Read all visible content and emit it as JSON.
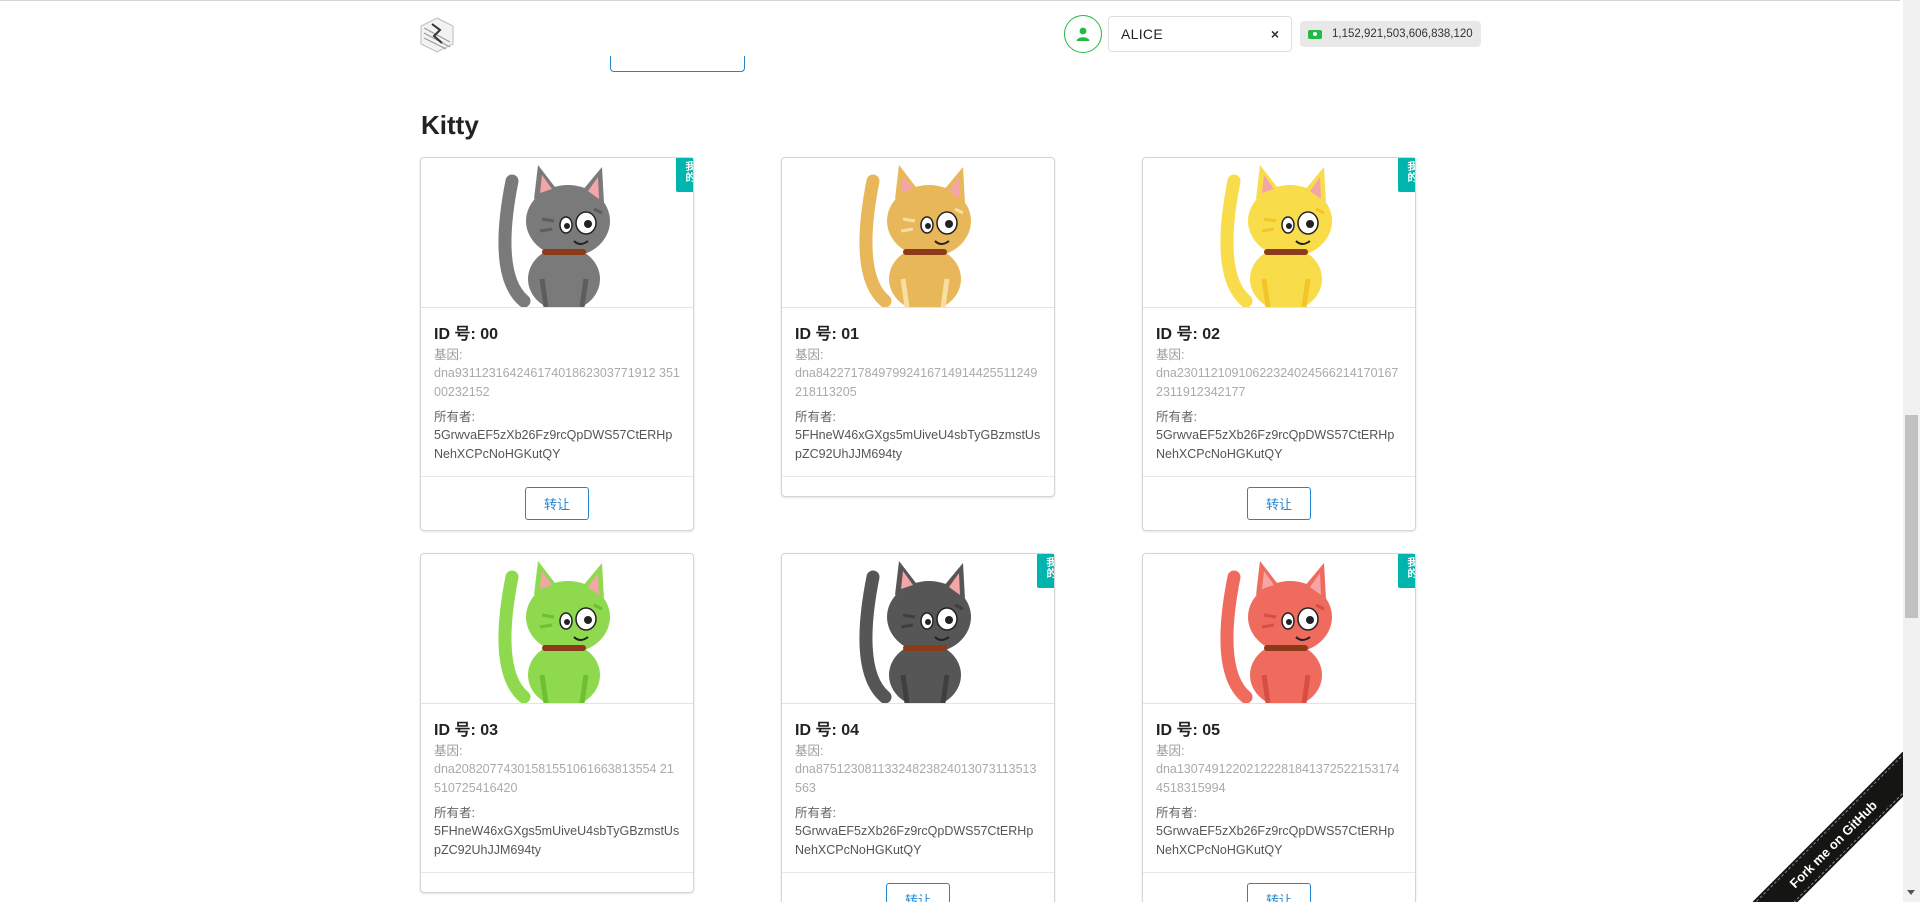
{
  "header": {
    "account_name": "ALICE",
    "clear_glyph": "×",
    "balance": "1,152,921,503,606,838,120",
    "icons": {
      "logo": "cube-logo-icon",
      "user": "user-icon",
      "cash": "money-icon"
    }
  },
  "section": {
    "title": "Kitty"
  },
  "labels": {
    "gene": "基因:",
    "owner": "所有者:",
    "transfer": "转让",
    "mine_badge": "我的"
  },
  "kitties": [
    {
      "id_label": "ID 号: 00",
      "dna": "dna93112316424617401862303771912 35100232152",
      "owner": "5GrwvaEF5zXb26Fz9rcQpDWS57CtERHpNehXCPcNoHGKutQY",
      "mine": true,
      "color": "#7a7a7a",
      "stripe": "#5d5d5d"
    },
    {
      "id_label": "ID 号: 01",
      "dna": "dna84227178497992416714914425511249218113205",
      "owner": "5FHneW46xGXgs5mUiveU4sbTyGBzmstUspZC92UhJJM694ty",
      "mine": false,
      "color": "#e8b75a",
      "stripe": "#f6dfa0"
    },
    {
      "id_label": "ID 号: 02",
      "dna": "dna230112109106223240245662141701672311912342177",
      "owner": "5GrwvaEF5zXb26Fz9rcQpDWS57CtERHpNehXCPcNoHGKutQY",
      "mine": true,
      "color": "#f9dc4a",
      "stripe": "#f3c52a"
    },
    {
      "id_label": "ID 号: 03",
      "dna": "dna20820774301581551061663813554 21510725416420",
      "owner": "5FHneW46xGXgs5mUiveU4sbTyGBzmstUspZC92UhJJM694ty",
      "mine": false,
      "color": "#8fd94f",
      "stripe": "#6dbf34"
    },
    {
      "id_label": "ID 号: 04",
      "dna": "dna87512308113324823824013073113513563",
      "owner": "5GrwvaEF5zXb26Fz9rcQpDWS57CtERHpNehXCPcNoHGKutQY",
      "mine": true,
      "color": "#565656",
      "stripe": "#3f3f3f"
    },
    {
      "id_label": "ID 号: 05",
      "dna": "dna130749122021222818413725221531744518315994",
      "owner": "5GrwvaEF5zXb26Fz9rcQpDWS57CtERHpNehXCPcNoHGKutQY",
      "mine": true,
      "color": "#ef6b5e",
      "stripe": "#d94e44"
    }
  ],
  "ribbon": {
    "text": "Fork me on GitHub"
  },
  "colors": {
    "accent_blue": "#2185d0",
    "badge_teal": "#00b5ad",
    "green": "#21ba45"
  }
}
